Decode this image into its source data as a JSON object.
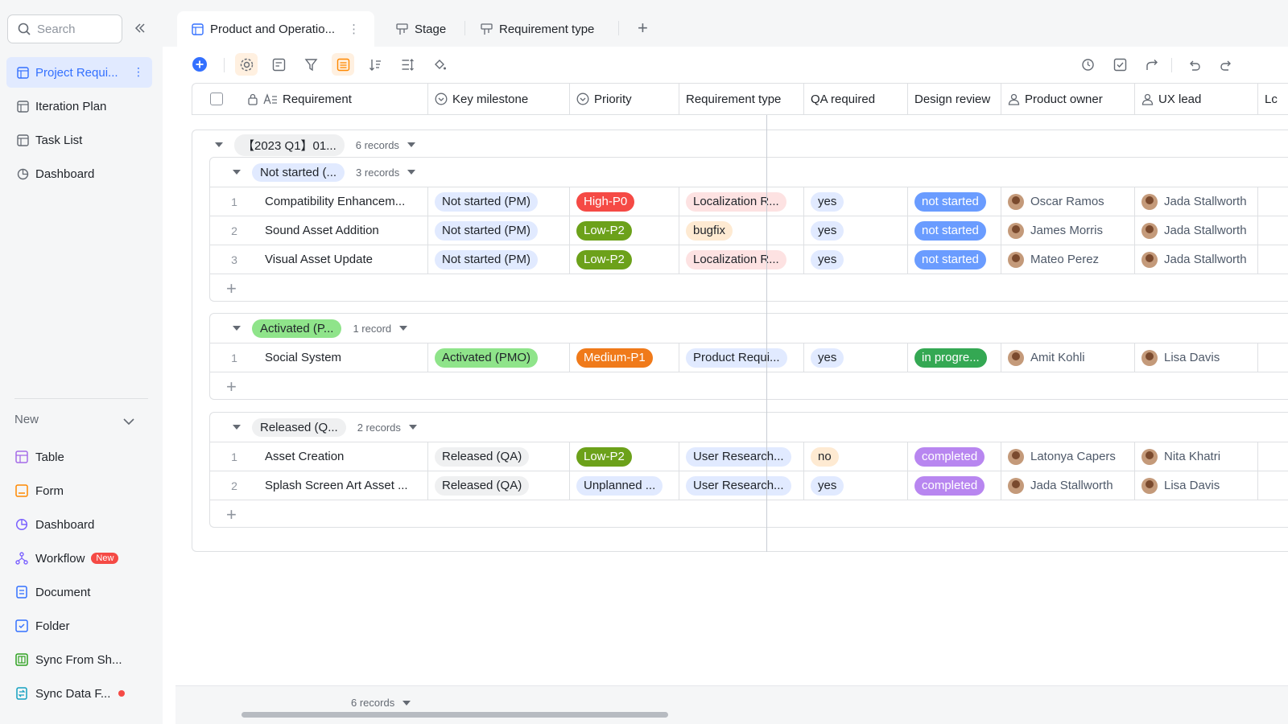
{
  "sidebar": {
    "search_placeholder": "Search",
    "nav": [
      {
        "label": "Project Requi...",
        "icon": "table-icon",
        "active": true
      },
      {
        "label": "Iteration Plan",
        "icon": "table-icon"
      },
      {
        "label": "Task List",
        "icon": "table-icon"
      },
      {
        "label": "Dashboard",
        "icon": "dashboard-icon"
      }
    ],
    "new_label": "New",
    "create": [
      {
        "label": "Table",
        "icon": "table-icon",
        "color": "#a56be8"
      },
      {
        "label": "Form",
        "icon": "form-icon",
        "color": "#ff8800"
      },
      {
        "label": "Dashboard",
        "icon": "dashboard-icon",
        "color": "#7b61ff"
      },
      {
        "label": "Workflow",
        "icon": "workflow-icon",
        "color": "#7b61ff",
        "badge": "New"
      },
      {
        "label": "Document",
        "icon": "document-icon",
        "color": "#3370ff"
      },
      {
        "label": "Folder",
        "icon": "folder-icon",
        "color": "#3370ff"
      },
      {
        "label": "Sync From Sh...",
        "icon": "sheet-icon",
        "color": "#2ea121"
      },
      {
        "label": "Sync Data F...",
        "icon": "sync-icon",
        "color": "#14c0ff"
      }
    ]
  },
  "tabs": [
    {
      "label": "Product and Operatio...",
      "active": true
    },
    {
      "label": "Stage"
    },
    {
      "label": "Requirement type"
    }
  ],
  "columns": [
    "Requirement",
    "Key milestone",
    "Priority",
    "Requirement type",
    "QA required",
    "Design review",
    "Product owner",
    "UX lead",
    "Lc"
  ],
  "top_group": {
    "label": "【2023 Q1】01...",
    "count": "6 records"
  },
  "groups": [
    {
      "label": "Not started (...",
      "count": "3 records",
      "bg": "#e1eaff",
      "rows": [
        {
          "num": "1",
          "requirement": "Compatibility Enhancem...",
          "milestone": "Not started (PM)",
          "priority": "High-P0",
          "req_type": "Localization R...",
          "qa": "yes",
          "design": "not started",
          "owner": "Oscar Ramos",
          "ux": "Jada Stallworth"
        },
        {
          "num": "2",
          "requirement": "Sound Asset Addition",
          "milestone": "Not started (PM)",
          "priority": "Low-P2",
          "req_type": "bugfix",
          "qa": "yes",
          "design": "not started",
          "owner": "James Morris",
          "ux": "Jada Stallworth"
        },
        {
          "num": "3",
          "requirement": "Visual Asset Update",
          "milestone": "Not started (PM)",
          "priority": "Low-P2",
          "req_type": "Localization R...",
          "qa": "yes",
          "design": "not started",
          "owner": "Mateo Perez",
          "ux": "Jada Stallworth"
        }
      ]
    },
    {
      "label": "Activated (P...",
      "count": "1 record",
      "bg": "#8fe48a",
      "rows": [
        {
          "num": "1",
          "requirement": "Social System",
          "milestone": "Activated (PMO)",
          "priority": "Medium-P1",
          "req_type": "Product Requi...",
          "qa": "yes",
          "design": "in progre...",
          "owner": "Amit Kohli",
          "ux": "Lisa Davis"
        }
      ]
    },
    {
      "label": "Released (Q...",
      "count": "2 records",
      "bg": "#eff0f1",
      "rows": [
        {
          "num": "1",
          "requirement": "Asset Creation",
          "milestone": "Released (QA)",
          "priority": "Low-P2",
          "req_type": "User Research...",
          "qa": "no",
          "design": "completed",
          "owner": "Latonya Capers",
          "ux": "Nita Khatri"
        },
        {
          "num": "2",
          "requirement": "Splash Screen Art Asset ...",
          "milestone": "Released (QA)",
          "priority": "Unplanned ...",
          "req_type": "User Research...",
          "qa": "yes",
          "design": "completed",
          "owner": "Jada Stallworth",
          "ux": "Lisa Davis"
        }
      ]
    }
  ],
  "footer_count": "6 records"
}
